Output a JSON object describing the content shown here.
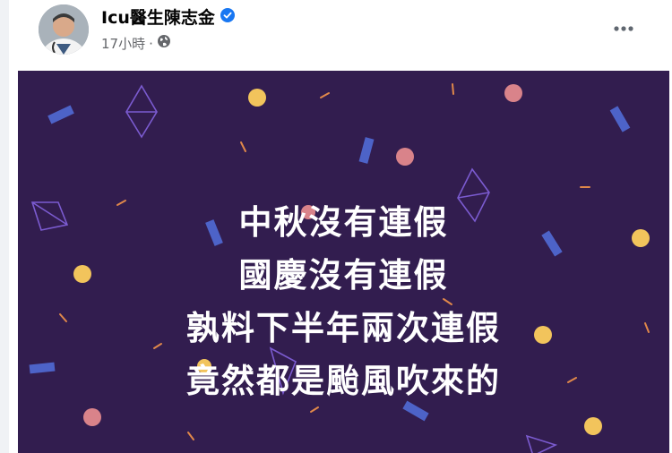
{
  "post": {
    "author_name": "Icu醫生陳志金",
    "timestamp": "17小時",
    "separator": "·",
    "privacy_icon": "globe-icon",
    "verified_icon": "verified-badge-icon",
    "more_icon": "more-options-icon",
    "colors": {
      "verified": "#1877f2",
      "image_background": "#321d4f",
      "image_text": "#ffffff"
    },
    "image": {
      "lines": [
        "中秋沒有連假",
        "國慶沒有連假",
        "孰料下半年兩次連假",
        "竟然都是颱風吹來的"
      ]
    }
  }
}
